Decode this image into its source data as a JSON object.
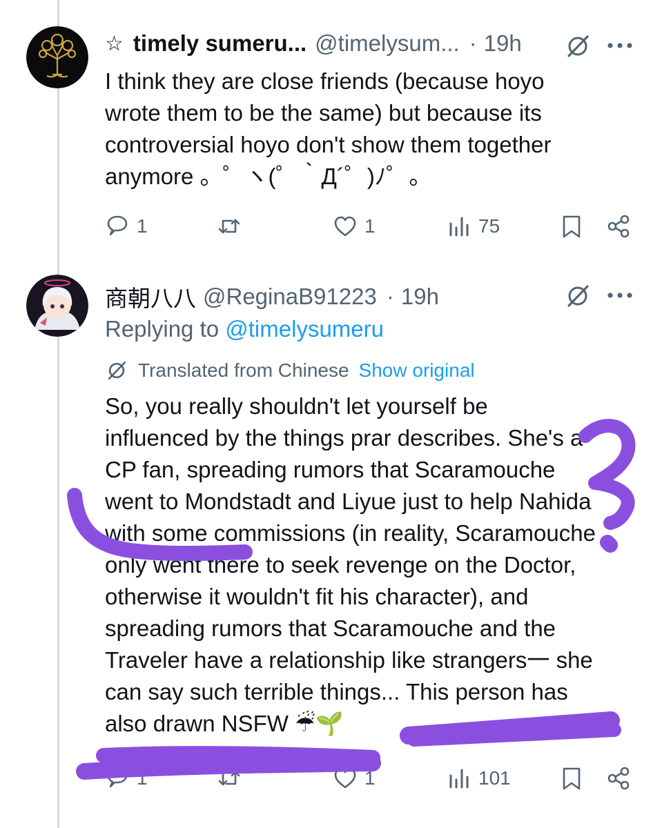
{
  "tweet1": {
    "star": "☆",
    "name": "timely sumeru...",
    "handle": "@timelysum...",
    "dot": "·",
    "time": "19h",
    "text_lines": [
      "I think they are close friends (because hoyo",
      "wrote them to be the same) but because its",
      "controversial hoyo don't show them together",
      "anymore 。゜ヽ(゜｀Д´゜)ﾉ゜。"
    ],
    "stats": {
      "replies": "1",
      "likes": "1",
      "views": "75"
    }
  },
  "tweet2": {
    "name": "商朝八八",
    "handle": "@ReginaB91223",
    "dot": "·",
    "time": "19h",
    "replying_prefix": "Replying to ",
    "replying_mention": "@timelysumeru",
    "translated_label": "Translated from Chinese",
    "show_original": "Show original",
    "text_lines": [
      "So, you really shouldn't let yourself be",
      "influenced by the things prar describes. She's a",
      "CP fan, spreading rumors that Scaramouche",
      "went to Mondstadt and Liyue just to help Nahida",
      "with some commissions (in reality, Scaramouche",
      "only went there to seek revenge on the Doctor,",
      "otherwise it wouldn't fit his character), and",
      "spreading rumors that Scaramouche and the",
      "Traveler have a relationship like strangers一 she",
      "can say such terrible things... This person has",
      "also drawn NSFW ☔🌱"
    ],
    "stats": {
      "replies": "1",
      "likes": "1",
      "views": "101"
    }
  },
  "icons": {
    "more": "more-options-icon",
    "grok": "grok-icon",
    "reply": "reply-icon",
    "retweet": "retweet-icon",
    "like": "like-icon",
    "views": "views-icon",
    "bookmark": "bookmark-icon",
    "share": "share-icon"
  },
  "colors": {
    "link": "#1d9bf0",
    "secondary_text": "#536471",
    "scribble": "#8b4fe0"
  }
}
